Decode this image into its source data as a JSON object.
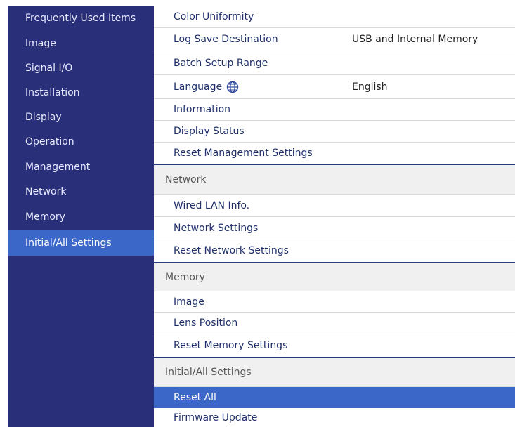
{
  "sidebar": {
    "items": [
      {
        "label": "Frequently Used Items"
      },
      {
        "label": "Image"
      },
      {
        "label": "Signal I/O"
      },
      {
        "label": "Installation"
      },
      {
        "label": "Display"
      },
      {
        "label": "Operation"
      },
      {
        "label": "Management"
      },
      {
        "label": "Network"
      },
      {
        "label": "Memory"
      },
      {
        "label": "Initial/All Settings"
      }
    ],
    "selected": "Initial/All Settings"
  },
  "content": {
    "management": {
      "items": [
        {
          "label": "Color Uniformity"
        },
        {
          "label": "Log Save Destination",
          "value": "USB and Internal Memory"
        },
        {
          "label": "Batch Setup Range"
        },
        {
          "label": "Language",
          "value": "English",
          "icon": "globe-icon"
        },
        {
          "label": "Information"
        },
        {
          "label": "Display Status"
        },
        {
          "label": "Reset Management Settings"
        }
      ]
    },
    "network": {
      "header": "Network",
      "items": [
        {
          "label": "Wired LAN Info."
        },
        {
          "label": "Network Settings"
        },
        {
          "label": "Reset Network Settings"
        }
      ]
    },
    "memory": {
      "header": "Memory",
      "items": [
        {
          "label": "Image"
        },
        {
          "label": "Lens Position"
        },
        {
          "label": "Reset Memory Settings"
        }
      ]
    },
    "initial": {
      "header": "Initial/All Settings",
      "items": [
        {
          "label": "Reset All"
        },
        {
          "label": "Firmware Update"
        }
      ],
      "selected": "Reset All"
    }
  },
  "colors": {
    "sidebar_bg": "#2a2f7a",
    "selection": "#3b67c9"
  }
}
